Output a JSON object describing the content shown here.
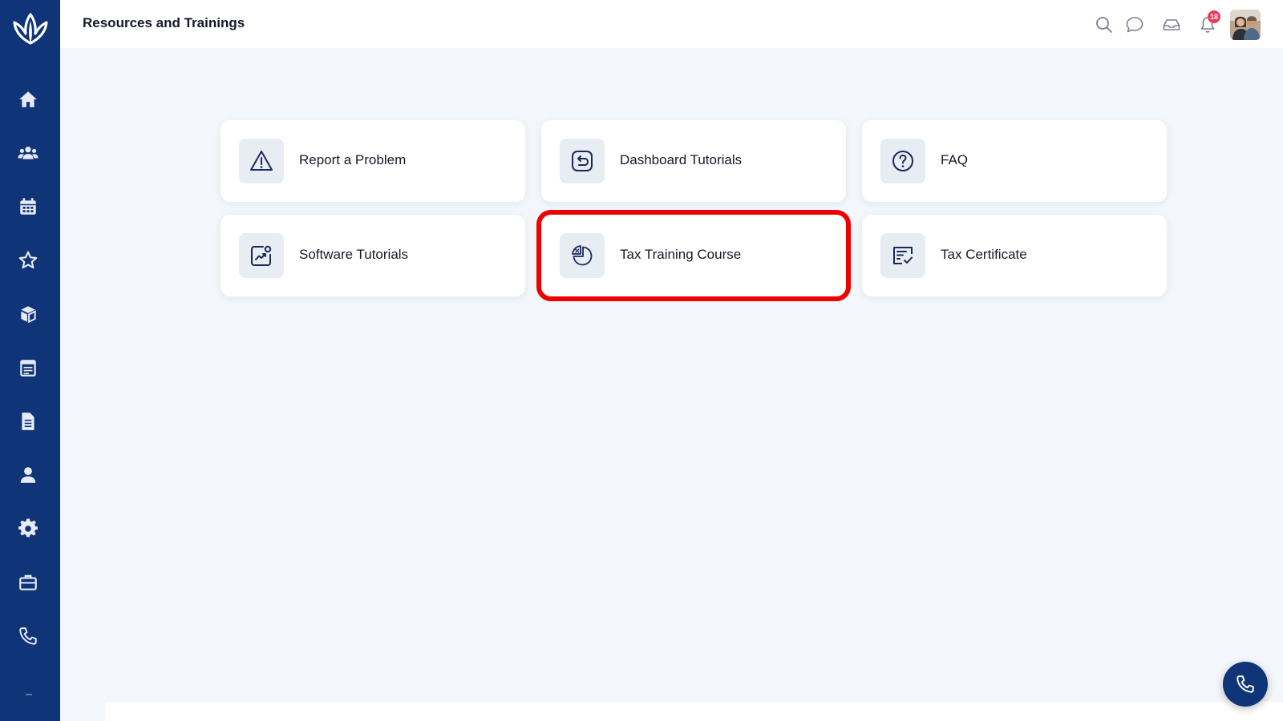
{
  "header": {
    "title": "Resources and Trainings",
    "notification_count": "18"
  },
  "sidebar": {
    "items": [
      {
        "icon": "home-icon"
      },
      {
        "icon": "users-icon"
      },
      {
        "icon": "calendar-icon"
      },
      {
        "icon": "star-icon"
      },
      {
        "icon": "box-icon"
      },
      {
        "icon": "schedule-icon"
      },
      {
        "icon": "document-icon"
      },
      {
        "icon": "user-icon"
      },
      {
        "icon": "gear-icon"
      },
      {
        "icon": "briefcase-icon"
      },
      {
        "icon": "phone-icon"
      }
    ]
  },
  "cards": [
    {
      "label": "Report a Problem",
      "icon": "warning-icon"
    },
    {
      "label": "Dashboard Tutorials",
      "icon": "return-icon"
    },
    {
      "label": "FAQ",
      "icon": "question-icon"
    },
    {
      "label": "Software Tutorials",
      "icon": "chart-user-icon"
    },
    {
      "label": "Tax Training Course",
      "icon": "percent-pie-icon",
      "highlighted": true
    },
    {
      "label": "Tax Certificate",
      "icon": "certificate-icon"
    }
  ],
  "colors": {
    "sidebar": "#0f3478",
    "accent": "#0f3478",
    "highlight": "#ee0000",
    "badge": "#ec3b5a",
    "background": "#f3f6fa"
  }
}
